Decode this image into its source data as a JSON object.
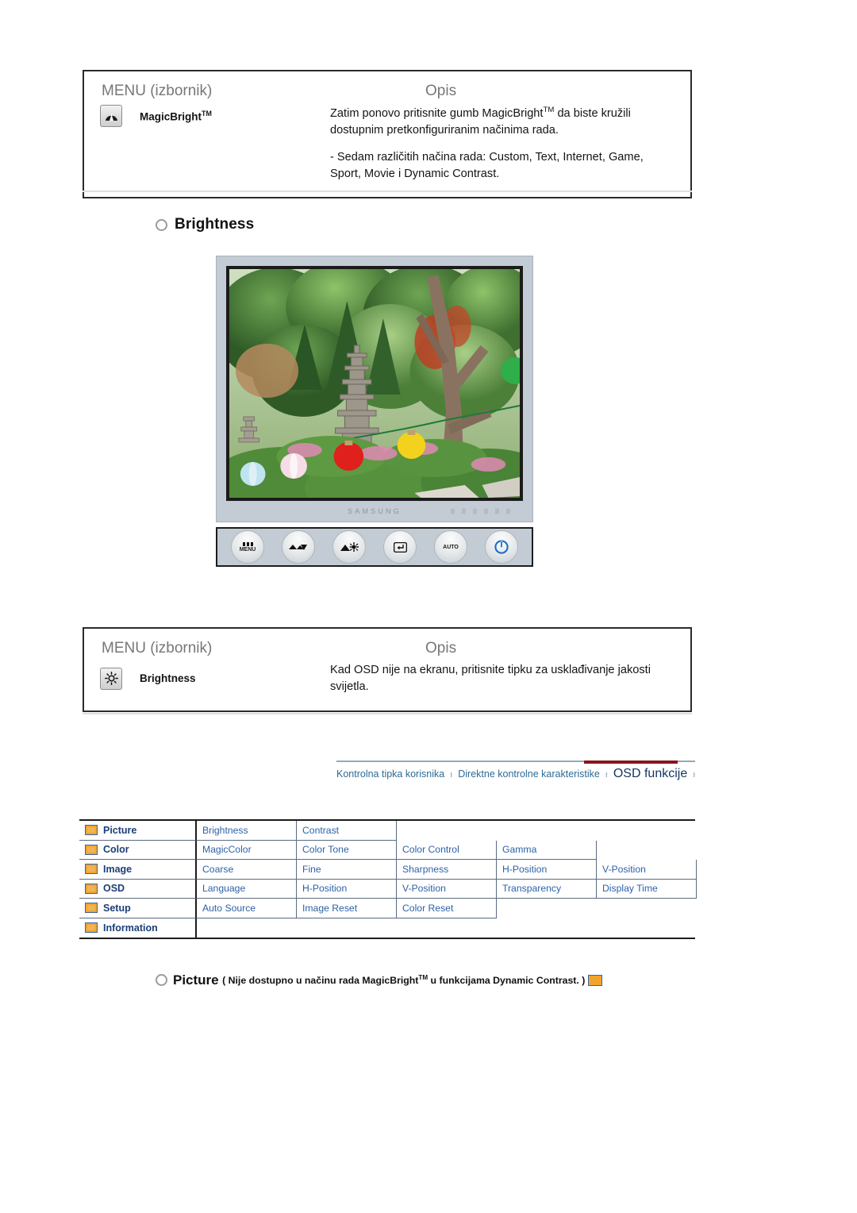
{
  "tables": {
    "headers": {
      "menu": "MENU (izbornik)",
      "description": "Opis"
    },
    "magicbright": {
      "icon": "magicbright-gauge-icon",
      "label": "MagicBright",
      "label_sup": "TM",
      "desc_p1_a": "Zatim ponovo pritisnite gumb MagicBright",
      "desc_p1_sup": "TM",
      "desc_p1_b": " da biste kružili dostupnim pretkonfiguriranim načinima rada.",
      "desc_p2": "- Sedam različitih načina rada: Custom, Text, Internet, Game, Sport, Movie i Dynamic Contrast."
    },
    "brightness": {
      "icon": "sun-icon",
      "label": "Brightness",
      "desc": "Kad OSD nije na ekranu, pritisnite tipku za usklađivanje jakosti svijetla."
    }
  },
  "section": {
    "brightness_heading": "Brightness"
  },
  "monitor": {
    "brand": "SAMSUNG",
    "buttons": [
      {
        "name": "menu-button",
        "label": "MENU",
        "glyph": "bars"
      },
      {
        "name": "down-adjust-button",
        "label": "",
        "glyph": "down"
      },
      {
        "name": "brightness-button",
        "label": "",
        "glyph": "brightness"
      },
      {
        "name": "enter-button",
        "label": "",
        "glyph": "enter"
      },
      {
        "name": "auto-button",
        "label": "AUTO",
        "glyph": "text"
      },
      {
        "name": "power-button",
        "label": "",
        "glyph": "power"
      }
    ]
  },
  "nav": {
    "items": [
      {
        "label": "Kontrolna tipka korisnika",
        "active": false
      },
      {
        "label": "Direktne kontrolne karakteristike",
        "active": false
      },
      {
        "label": "OSD funkcije",
        "active": true
      }
    ],
    "separator": "ı",
    "accent_color": "#8c1420",
    "link_color": "#2e6b93",
    "active_color": "#12355c"
  },
  "osd_table": {
    "rows": [
      {
        "category": "Picture",
        "icon": "picture-icon",
        "items": [
          "Brightness",
          "Contrast"
        ]
      },
      {
        "category": "Color",
        "icon": "color-icon",
        "items": [
          "MagicColor",
          "Color Tone",
          "Color Control",
          "Gamma"
        ]
      },
      {
        "category": "Image",
        "icon": "image-icon",
        "items": [
          "Coarse",
          "Fine",
          "Sharpness",
          "H-Position",
          "V-Position"
        ]
      },
      {
        "category": "OSD",
        "icon": "osd-icon",
        "items": [
          "Language",
          "H-Position",
          "V-Position",
          "Transparency",
          "Display Time"
        ]
      },
      {
        "category": "Setup",
        "icon": "setup-icon",
        "items": [
          "Auto Source",
          "Image Reset",
          "Color Reset"
        ]
      },
      {
        "category": "Information",
        "icon": "information-icon",
        "items": []
      }
    ]
  },
  "picture_note": {
    "title": "Picture",
    "text_a": "( Nije dostupno u načinu rada MagicBright",
    "text_sup": "TM",
    "text_b": " u funkcijama Dynamic Contrast. )",
    "icon": "picture-icon"
  }
}
